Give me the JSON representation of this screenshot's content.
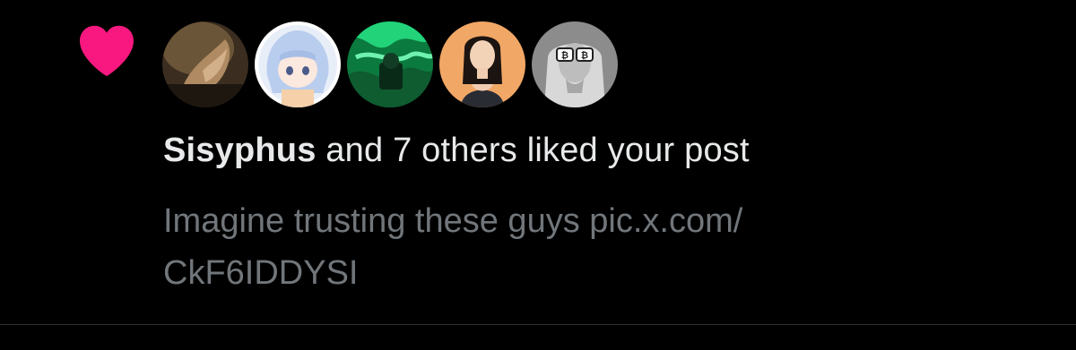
{
  "notification": {
    "type": "like",
    "icon": "heart-icon",
    "accent_color": "#f91880",
    "avatars": [
      {
        "name": "avatar-classical-painting",
        "bg": "#4a3b2a"
      },
      {
        "name": "avatar-anime-girl",
        "bg": "#dfe7f5"
      },
      {
        "name": "avatar-green-abstract",
        "bg": "#0a8f4a"
      },
      {
        "name": "avatar-woman-illustration",
        "bg": "#f2a86a"
      },
      {
        "name": "avatar-bitcoin-glasses",
        "bg": "#9a9a9a"
      }
    ],
    "actor": "Sisyphus",
    "action_text": " and 7 others liked your post",
    "post_text_line1": "Imagine trusting these guys pic.x.com/",
    "post_text_line2": "CkF6IDDYSI"
  }
}
